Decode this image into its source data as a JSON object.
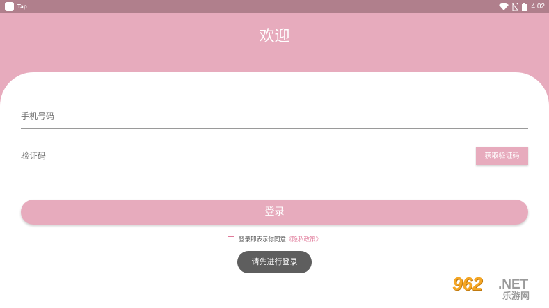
{
  "statusbar": {
    "app_name": "Tap",
    "time": "4:02"
  },
  "header": {
    "title": "欢迎"
  },
  "form": {
    "phone_placeholder": "手机号码",
    "phone_value": "",
    "code_placeholder": "验证码",
    "code_value": "",
    "get_code_label": "获取验证码",
    "login_label": "登录"
  },
  "agreement": {
    "checked": false,
    "text": "登录即表示你同意",
    "link_label": "《隐私政策》"
  },
  "toast": {
    "message": "请先进行登录"
  },
  "watermark": {
    "top": "962",
    "dot": ".NET",
    "bottom": "乐游网"
  },
  "colors": {
    "accent": "#e7abbd",
    "statusbar": "#b07f8c",
    "link": "#e07a9a",
    "toast": "#5e5e5e"
  }
}
